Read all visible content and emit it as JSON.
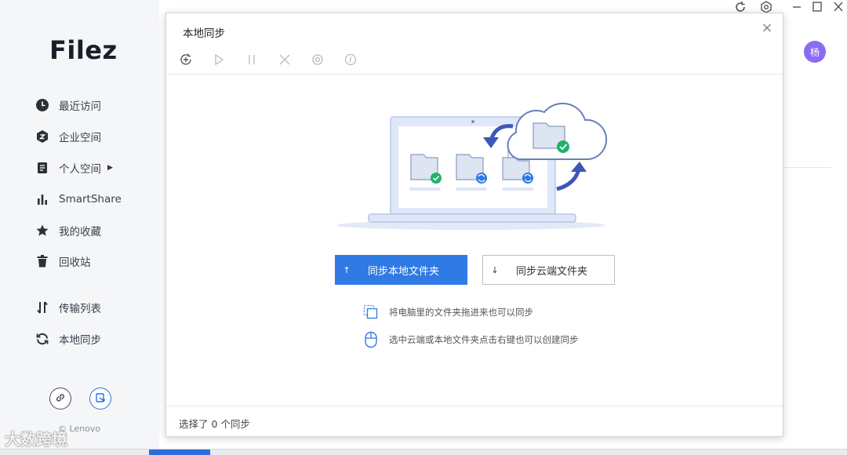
{
  "app": {
    "logo": "Filez",
    "copyright": "© Lenovo",
    "avatar_text": "杨",
    "accent_color": "#2f7ae5"
  },
  "sidebar": {
    "items": [
      {
        "label": "最近访问",
        "icon": "clock-icon"
      },
      {
        "label": "企业空间",
        "icon": "enterprise-icon"
      },
      {
        "label": "个人空间",
        "icon": "personal-icon",
        "has_submenu": true
      },
      {
        "label": "SmartShare",
        "icon": "chart-bars-icon"
      },
      {
        "label": "我的收藏",
        "icon": "star-icon"
      },
      {
        "label": "回收站",
        "icon": "trash-icon"
      },
      {
        "label": "传输列表",
        "icon": "transfer-icon"
      },
      {
        "label": "本地同步",
        "icon": "sync-icon"
      }
    ],
    "bottom_buttons": [
      {
        "icon": "link-icon"
      },
      {
        "icon": "share-edit-icon"
      }
    ]
  },
  "window_controls": {
    "icons": [
      "refresh-icon",
      "settings-icon",
      "minimize-icon",
      "maximize-icon",
      "close-icon"
    ]
  },
  "dialog": {
    "title": "本地同步",
    "close": "×",
    "toolbar": [
      "add-sync-icon",
      "play-icon",
      "pause-icon",
      "cancel-icon",
      "settings-icon",
      "info-icon"
    ],
    "primary_button": {
      "label": "同步本地文件夹",
      "icon": "↑"
    },
    "secondary_button": {
      "label": "同步云端文件夹",
      "icon": "↓"
    },
    "hints": [
      {
        "text": "将电脑里的文件夹拖进来也可以同步",
        "icon": "drag-icon"
      },
      {
        "text": "选中云端或本地文件夹点击右键也可以创建同步",
        "icon": "mouse-icon"
      }
    ],
    "status": "选择了 0 个同步"
  },
  "watermark": "大数跨境"
}
